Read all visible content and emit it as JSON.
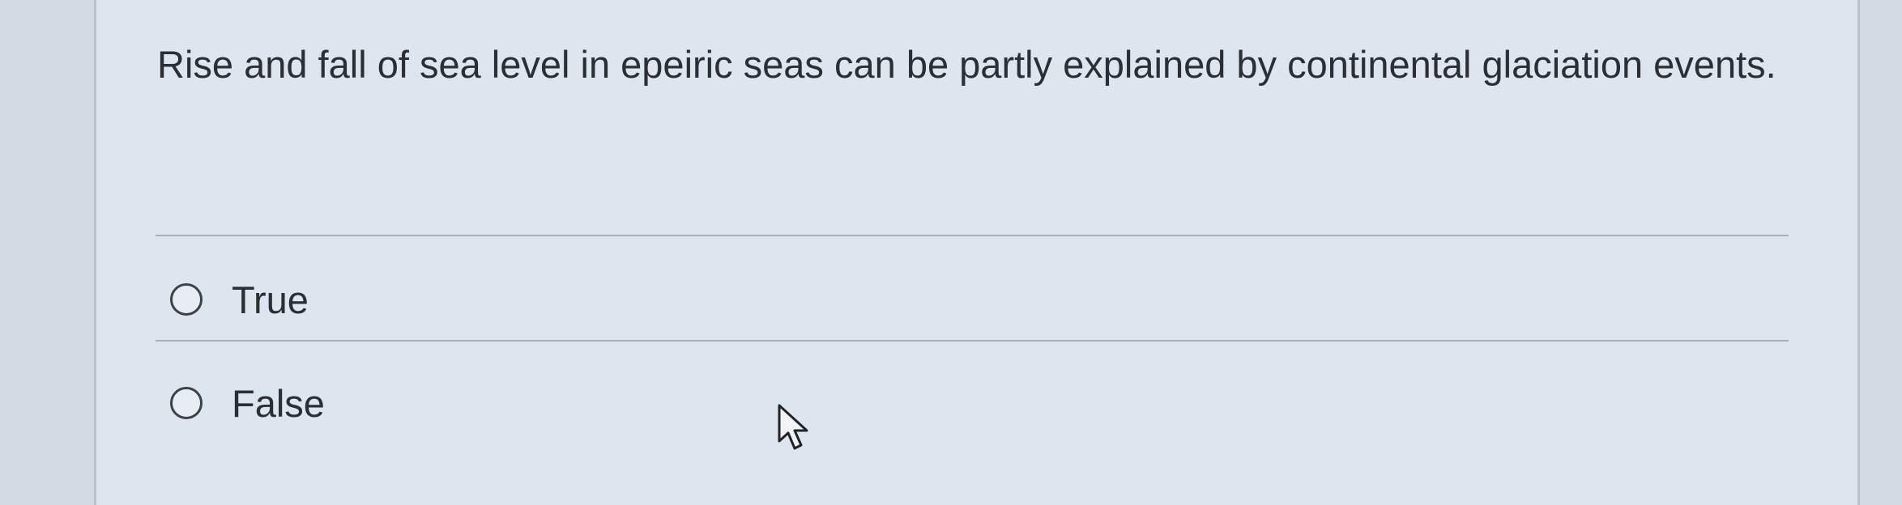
{
  "question": {
    "text": "Rise and fall of sea level in epeiric seas can be partly explained by continental glaciation events."
  },
  "options": [
    {
      "label": "True",
      "selected": false
    },
    {
      "label": "False",
      "selected": false
    }
  ],
  "icons": {
    "cursor": "mouse-pointer-icon",
    "radio": "radio-button-icon"
  }
}
